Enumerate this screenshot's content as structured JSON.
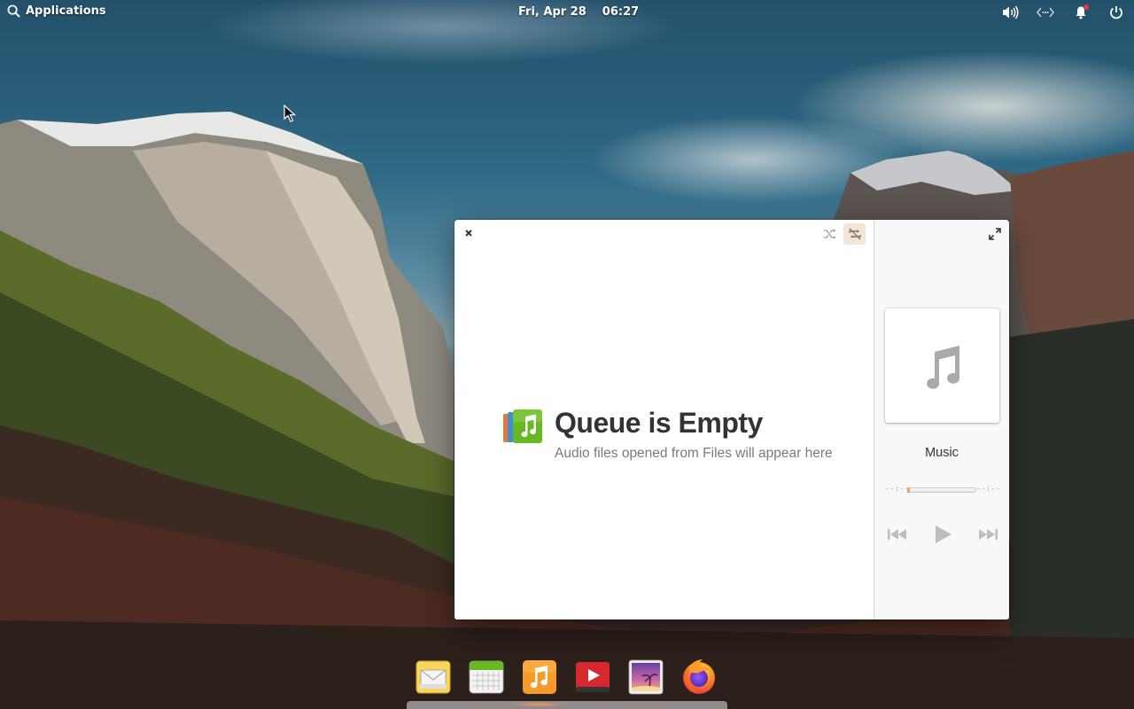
{
  "top_panel": {
    "applications_label": "Applications",
    "date": "Fri, Apr 28",
    "time": "06:27",
    "indicators": [
      "volume-icon",
      "network-icon",
      "notifications-icon",
      "power-icon"
    ]
  },
  "music_window": {
    "header": {
      "close_icon": "close-icon",
      "shuffle_icon": "shuffle-icon",
      "repeat_icon": "repeat-off-icon",
      "fullscreen_icon": "fullscreen-icon"
    },
    "empty_state": {
      "title": "Queue is Empty",
      "subtitle": "Audio files opened from Files will appear here"
    },
    "now_playing": {
      "title": "Music",
      "elapsed": "--:--",
      "remaining": "--:--",
      "progress": 0
    },
    "controls": [
      "previous-icon",
      "play-icon",
      "next-icon"
    ],
    "accent_color": "#f37329"
  },
  "dock": {
    "items": [
      "mail-app",
      "calendar-app",
      "music-app",
      "videos-app",
      "photos-app",
      "firefox-app"
    ]
  }
}
